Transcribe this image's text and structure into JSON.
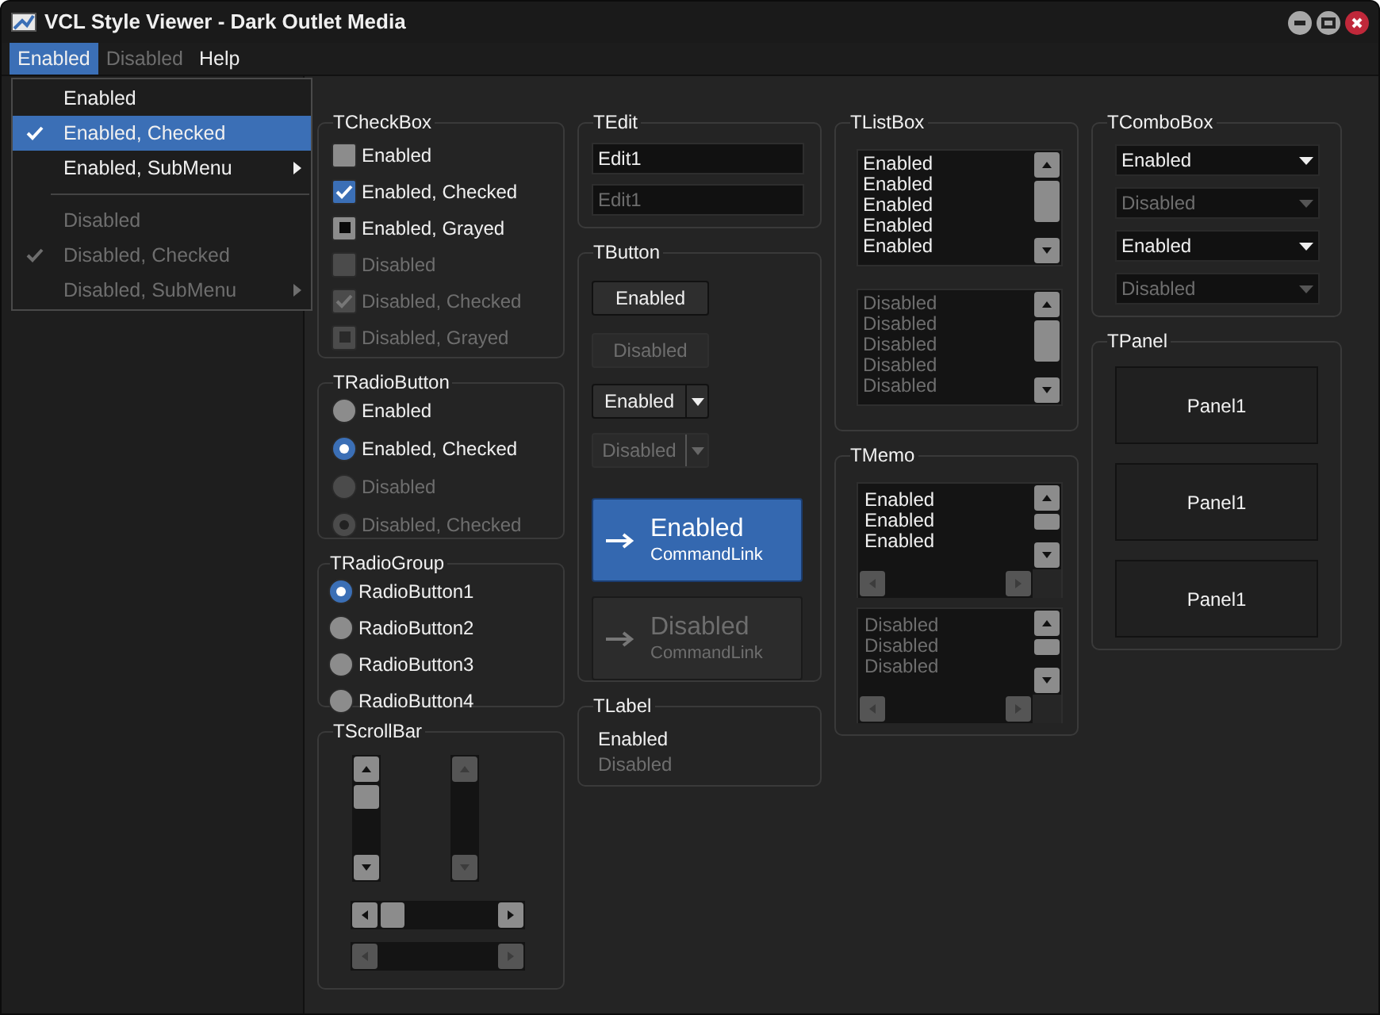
{
  "window": {
    "title": "VCL Style Viewer - Dark Outlet Media"
  },
  "menu_bar": [
    {
      "label": "Enabled",
      "selected": true,
      "disabled": false
    },
    {
      "label": "Disabled",
      "selected": false,
      "disabled": true
    },
    {
      "label": "Help",
      "selected": false,
      "disabled": false
    }
  ],
  "dropdown_menu": [
    {
      "kind": "item",
      "label": "Enabled",
      "checked": false,
      "disabled": false,
      "submenu": false,
      "selected": false
    },
    {
      "kind": "item",
      "label": "Enabled, Checked",
      "checked": true,
      "disabled": false,
      "submenu": false,
      "selected": true
    },
    {
      "kind": "item",
      "label": "Enabled, SubMenu",
      "checked": false,
      "disabled": false,
      "submenu": true,
      "selected": false
    },
    {
      "kind": "separator"
    },
    {
      "kind": "item",
      "label": "Disabled",
      "checked": false,
      "disabled": true,
      "submenu": false,
      "selected": false
    },
    {
      "kind": "item",
      "label": "Disabled, Checked",
      "checked": true,
      "disabled": true,
      "submenu": false,
      "selected": false
    },
    {
      "kind": "item",
      "label": "Disabled, SubMenu",
      "checked": false,
      "disabled": true,
      "submenu": true,
      "selected": false
    }
  ],
  "checkbox_group": {
    "title": "TCheckBox",
    "items": [
      {
        "label": "Enabled",
        "checked": false,
        "grayed": false,
        "disabled": false
      },
      {
        "label": "Enabled, Checked",
        "checked": true,
        "grayed": false,
        "disabled": false
      },
      {
        "label": "Enabled, Grayed",
        "checked": false,
        "grayed": true,
        "disabled": false
      },
      {
        "label": "Disabled",
        "checked": false,
        "grayed": false,
        "disabled": true
      },
      {
        "label": "Disabled, Checked",
        "checked": true,
        "grayed": false,
        "disabled": true
      },
      {
        "label": "Disabled, Grayed",
        "checked": false,
        "grayed": true,
        "disabled": true
      }
    ]
  },
  "radio_button_group": {
    "title": "TRadioButton",
    "items": [
      {
        "label": "Enabled",
        "checked": false,
        "disabled": false
      },
      {
        "label": "Enabled, Checked",
        "checked": true,
        "disabled": false
      },
      {
        "label": "Disabled",
        "checked": false,
        "disabled": true
      },
      {
        "label": "Disabled, Checked",
        "checked": true,
        "disabled": true
      }
    ]
  },
  "radio_group": {
    "title": "TRadioGroup",
    "items": [
      {
        "label": "RadioButton1",
        "selected": true
      },
      {
        "label": "RadioButton2",
        "selected": false
      },
      {
        "label": "RadioButton3",
        "selected": false
      },
      {
        "label": "RadioButton4",
        "selected": false
      }
    ]
  },
  "scrollbar_group": {
    "title": "TScrollBar",
    "bars": [
      {
        "kind": "vertical",
        "disabled": false
      },
      {
        "kind": "vertical",
        "disabled": true
      },
      {
        "kind": "horizontal",
        "disabled": false
      },
      {
        "kind": "horizontal",
        "disabled": true
      }
    ]
  },
  "edit_group": {
    "title": "TEdit",
    "fields": [
      {
        "value": "Edit1",
        "disabled": false
      },
      {
        "value": "Edit1",
        "disabled": true
      }
    ]
  },
  "button_group": {
    "title": "TButton",
    "buttons": [
      {
        "kind": "button",
        "label": "Enabled",
        "disabled": false
      },
      {
        "kind": "button",
        "label": "Disabled",
        "disabled": true
      },
      {
        "kind": "split",
        "label": "Enabled",
        "disabled": false
      },
      {
        "kind": "split",
        "label": "Disabled",
        "disabled": true
      },
      {
        "kind": "command_link",
        "label": "Enabled",
        "note": "CommandLink",
        "disabled": false
      },
      {
        "kind": "command_link",
        "label": "Disabled",
        "note": "CommandLink",
        "disabled": true
      }
    ]
  },
  "label_group": {
    "title": "TLabel",
    "labels": [
      {
        "text": "Enabled",
        "disabled": false
      },
      {
        "text": "Disabled",
        "disabled": true
      }
    ]
  },
  "listbox_group": {
    "title": "TListBox",
    "lists": [
      {
        "disabled": false,
        "items": [
          "Enabled",
          "Enabled",
          "Enabled",
          "Enabled",
          "Enabled"
        ]
      },
      {
        "disabled": true,
        "items": [
          "Disabled",
          "Disabled",
          "Disabled",
          "Disabled",
          "Disabled"
        ]
      }
    ]
  },
  "memo_group": {
    "title": "TMemo",
    "memos": [
      {
        "disabled": false,
        "lines": [
          "Enabled",
          "Enabled",
          "Enabled"
        ]
      },
      {
        "disabled": true,
        "lines": [
          "Disabled",
          "Disabled",
          "Disabled"
        ]
      }
    ]
  },
  "combobox_group": {
    "title": "TComboBox",
    "combos": [
      {
        "value": "Enabled",
        "disabled": false
      },
      {
        "value": "Disabled",
        "disabled": true
      },
      {
        "value": "Enabled",
        "disabled": false
      },
      {
        "value": "Disabled",
        "disabled": true
      }
    ]
  },
  "panel_group": {
    "title": "TPanel",
    "panels": [
      "Panel1",
      "Panel1",
      "Panel1"
    ]
  }
}
